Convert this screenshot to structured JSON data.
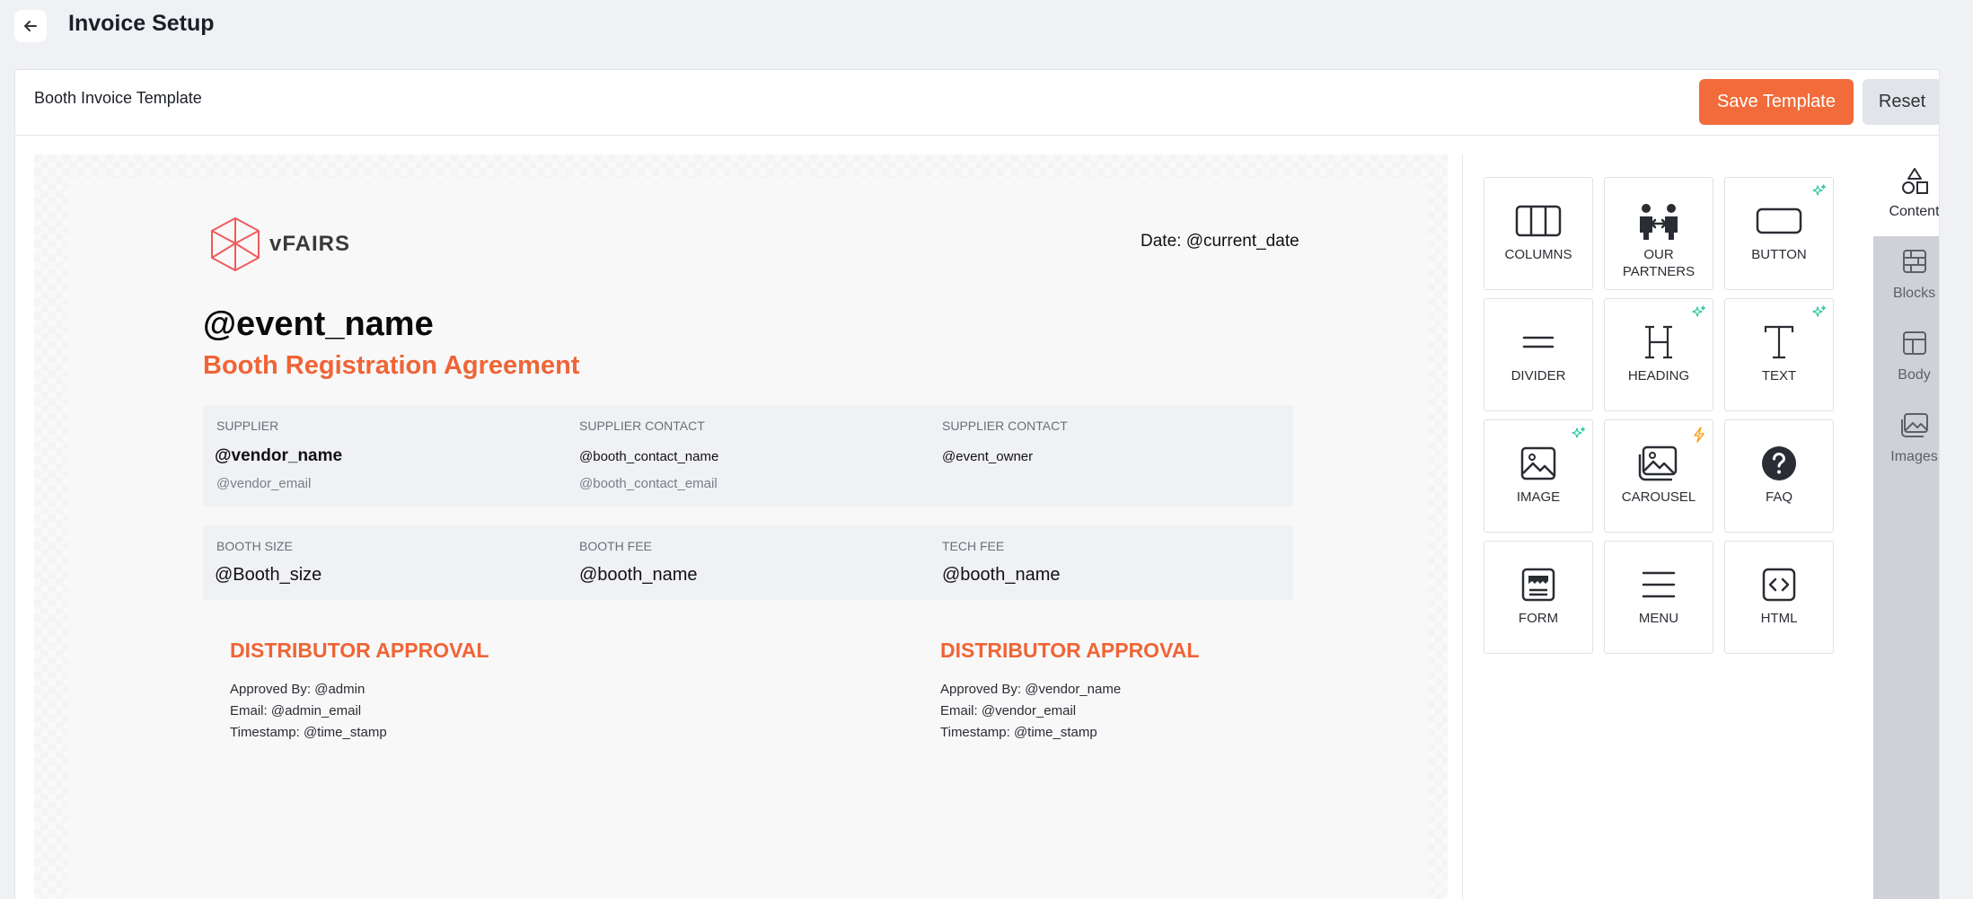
{
  "header": {
    "title": "Invoice Setup"
  },
  "toolbar": {
    "template_name": "Booth Invoice Template",
    "save_label": "Save Template",
    "reset_label": "Reset"
  },
  "document": {
    "logo_text": "vFAIRS",
    "date": "Date: @current_date",
    "event_name": "@event_name",
    "agreement_title": "Booth Registration Agreement",
    "supplier": {
      "label": "SUPPLIER",
      "name": "@vendor_name",
      "email": "@vendor_email"
    },
    "supplier_contact": {
      "label": "SUPPLIER CONTACT",
      "name": "@booth_contact_name",
      "email": "@booth_contact_email"
    },
    "supplier_contact_2": {
      "label": "SUPPLIER CONTACT",
      "value": "@event_owner"
    },
    "booth_size": {
      "label": "BOOTH SIZE",
      "value": "@Booth_size"
    },
    "booth_fee": {
      "label": "BOOTH FEE",
      "value": "@booth_name"
    },
    "tech_fee": {
      "label": "TECH FEE",
      "value": "@booth_name"
    },
    "approval_left": {
      "heading": "DISTRIBUTOR APPROVAL",
      "approved_by": "Approved By: @admin",
      "email": "Email: @admin_email",
      "timestamp": "Timestamp: @time_stamp"
    },
    "approval_right": {
      "heading": "DISTRIBUTOR APPROVAL",
      "approved_by": "Approved By: @vendor_name",
      "email": "Email: @vendor_email",
      "timestamp": "Timestamp: @time_stamp"
    }
  },
  "tools": [
    {
      "label": "COLUMNS",
      "icon": "columns-icon",
      "badge": ""
    },
    {
      "label": "OUR PARTNERS",
      "icon": "partners-icon",
      "badge": ""
    },
    {
      "label": "BUTTON",
      "icon": "button-icon",
      "badge": "sparkle-icon"
    },
    {
      "label": "DIVIDER",
      "icon": "divider-icon",
      "badge": ""
    },
    {
      "label": "HEADING",
      "icon": "heading-icon",
      "badge": "sparkle-icon"
    },
    {
      "label": "TEXT",
      "icon": "text-icon",
      "badge": "sparkle-icon"
    },
    {
      "label": "IMAGE",
      "icon": "image-icon",
      "badge": "sparkle-icon"
    },
    {
      "label": "CAROUSEL",
      "icon": "carousel-icon",
      "badge": "lightning-icon"
    },
    {
      "label": "FAQ",
      "icon": "faq-icon",
      "badge": ""
    },
    {
      "label": "FORM",
      "icon": "form-icon",
      "badge": ""
    },
    {
      "label": "MENU",
      "icon": "menu-icon",
      "badge": ""
    },
    {
      "label": "HTML",
      "icon": "html-icon",
      "badge": ""
    }
  ],
  "tabs": [
    {
      "label": "Content",
      "icon": "shapes-icon",
      "active": true
    },
    {
      "label": "Blocks",
      "icon": "blocks-icon",
      "active": false
    },
    {
      "label": "Body",
      "icon": "layout-icon",
      "active": false
    },
    {
      "label": "Images",
      "icon": "images-icon",
      "active": false
    }
  ],
  "colors": {
    "accent": "#f26b3a",
    "sparkle": "#2cc6a0",
    "lightning": "#f5a623"
  }
}
